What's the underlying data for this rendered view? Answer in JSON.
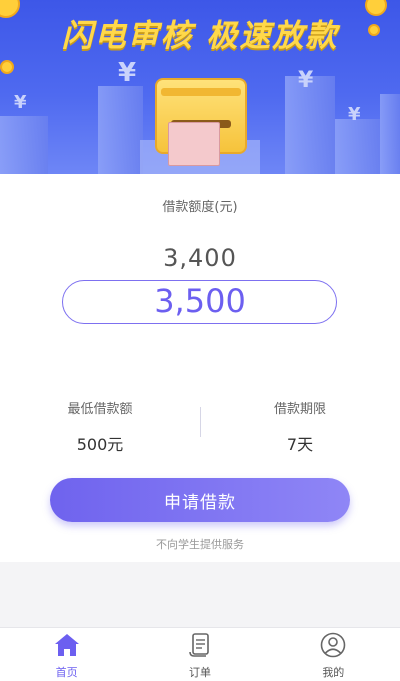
{
  "banner": {
    "headline": "闪电审核 极速放款",
    "colors": {
      "background": "#3d57e8",
      "headline": "#ffd84a"
    },
    "icons": [
      "coin-icon",
      "yen-sign-icon",
      "safe-box-icon",
      "banknote-icon"
    ]
  },
  "loan": {
    "amount_label": "借款额度(元)",
    "picker_previous": "3,400",
    "picker_current": "3,500",
    "min_amount_label": "最低借款额",
    "min_amount_value": "500元",
    "term_label": "借款期限",
    "term_value": "7天",
    "apply_button": "申请借款",
    "notice": "不向学生提供服务"
  },
  "tabbar": {
    "items": [
      {
        "label": "首页",
        "icon": "home-icon",
        "active": true
      },
      {
        "label": "订单",
        "icon": "order-scroll-icon",
        "active": false
      },
      {
        "label": "我的",
        "icon": "user-icon",
        "active": false
      }
    ]
  },
  "colors": {
    "accent": "#6c5ff0",
    "page_background": "#f4f4f6"
  }
}
